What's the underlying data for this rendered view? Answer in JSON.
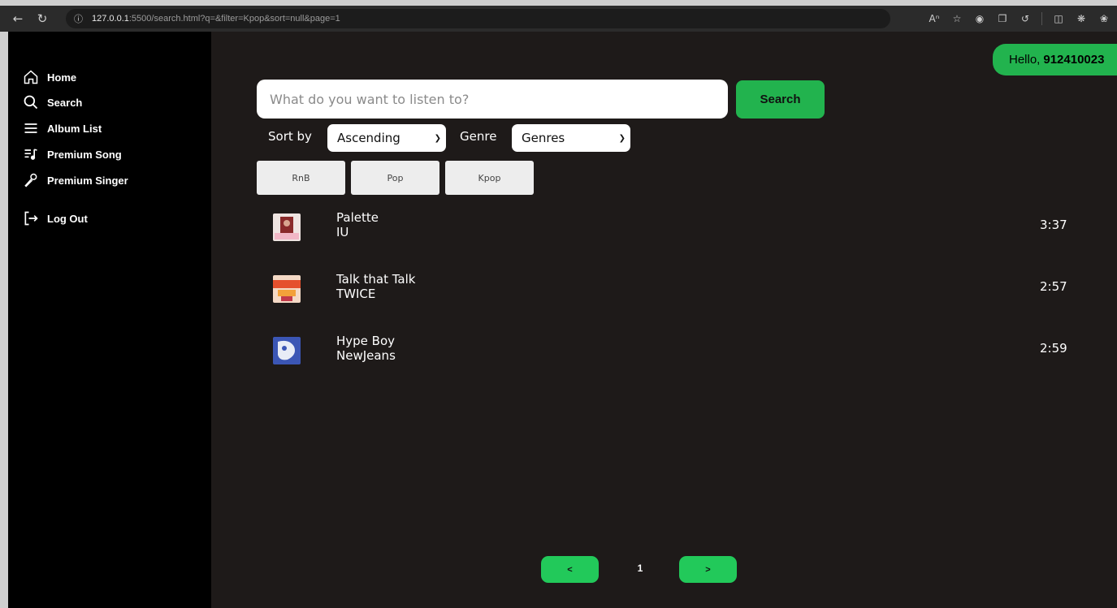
{
  "browser": {
    "address_host": "127.0.0.1",
    "address_rest": ":5500/search.html?q=&filter=Kpop&sort=null&page=1",
    "info_icon": "info-icon"
  },
  "sidebar": {
    "items": [
      {
        "label": "Home",
        "icon": "home-icon"
      },
      {
        "label": "Search",
        "icon": "search-icon"
      },
      {
        "label": "Album List",
        "icon": "list-icon"
      },
      {
        "label": "Premium Song",
        "icon": "music-list-icon"
      },
      {
        "label": "Premium Singer",
        "icon": "microphone-icon"
      },
      {
        "label": "Log Out",
        "icon": "logout-icon"
      }
    ]
  },
  "header": {
    "greeting": "Hello,",
    "username": "912410023"
  },
  "search": {
    "placeholder": "What do you want to listen to?",
    "button_label": "Search"
  },
  "filters": {
    "sort_label": "Sort by",
    "sort_value": "Ascending",
    "genre_label": "Genre",
    "genre_value": "Genres"
  },
  "genre_buttons": [
    "RnB",
    "Pop",
    "Kpop"
  ],
  "songs": [
    {
      "title": "Palette",
      "artist": "IU",
      "duration": "3:37",
      "cover_color": "#e8d4d0"
    },
    {
      "title": "Talk that Talk",
      "artist": "TWICE",
      "duration": "2:57",
      "cover_color": "#e9603c"
    },
    {
      "title": "Hype Boy",
      "artist": "NewJeans",
      "duration": "2:59",
      "cover_color": "#3e5bb7"
    }
  ],
  "pagination": {
    "prev_label": "<",
    "current_page": "1",
    "next_label": ">"
  },
  "colors": {
    "accent": "#22b34e",
    "main_bg": "#1e1a19",
    "sidebar_bg": "#000000"
  }
}
